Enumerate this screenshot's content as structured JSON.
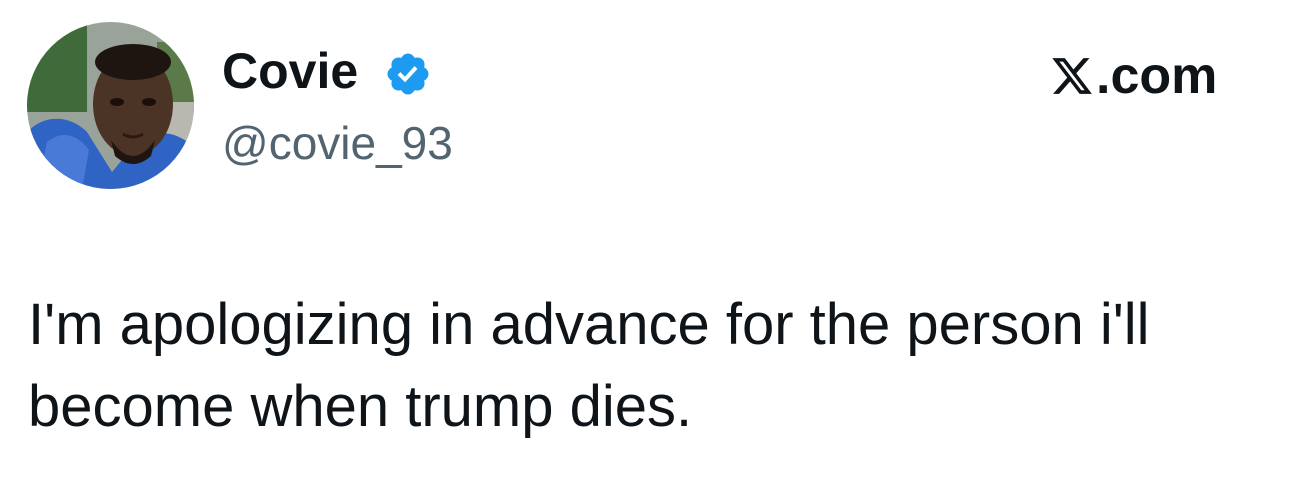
{
  "author": {
    "display_name": "Covie",
    "handle": "@covie_93",
    "verified": true,
    "avatar_icon": "profile-photo"
  },
  "site": {
    "logo_icon": "x-logo-icon",
    "suffix": ".com"
  },
  "tweet": {
    "text": "I'm apologizing in advance for the person i'll become when trump dies."
  },
  "colors": {
    "text_primary": "#0f1419",
    "text_secondary": "#536471",
    "verified_blue": "#1d9bf0",
    "background": "#ffffff"
  }
}
